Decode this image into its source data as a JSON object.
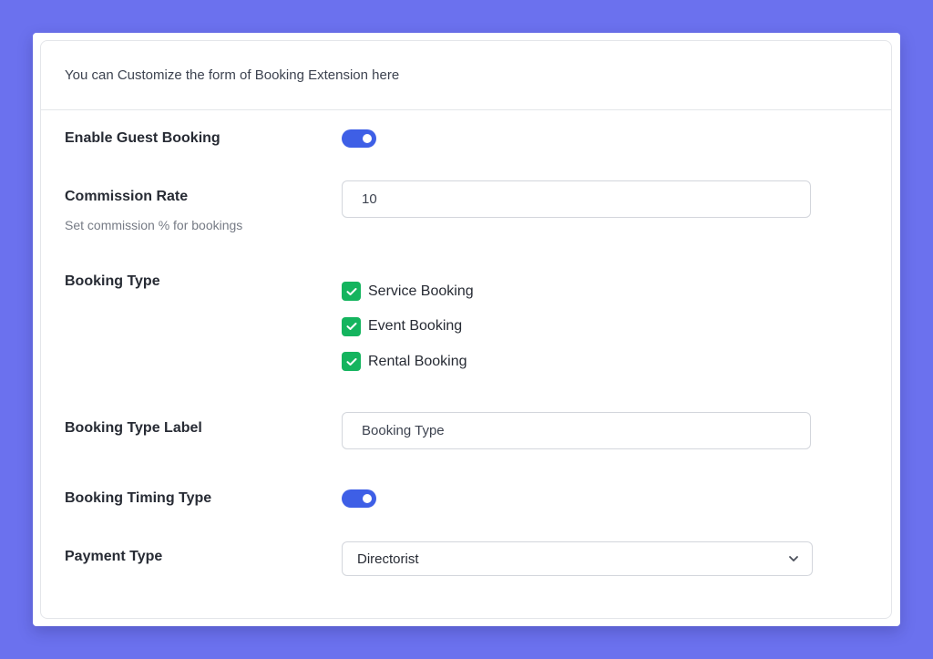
{
  "header": {
    "description": "You can Customize the form of Booking Extension here"
  },
  "settings": {
    "guest_booking": {
      "label": "Enable Guest Booking",
      "enabled": true
    },
    "commission": {
      "label": "Commission Rate",
      "help": "Set commission % for bookings",
      "value": "10"
    },
    "booking_type": {
      "label": "Booking Type",
      "options": [
        {
          "label": "Service Booking",
          "checked": true
        },
        {
          "label": "Event Booking",
          "checked": true
        },
        {
          "label": "Rental Booking",
          "checked": true
        }
      ]
    },
    "booking_type_label": {
      "label": "Booking Type Label",
      "value": "Booking Type"
    },
    "timing_type": {
      "label": "Booking Timing Type",
      "enabled": true
    },
    "payment_type": {
      "label": "Payment Type",
      "selected": "Directorist"
    }
  },
  "colors": {
    "background": "#6b71ee",
    "toggle_on": "#3e5fe6",
    "checkbox_checked": "#14b45e"
  },
  "icons": {
    "checkbox": "check-icon",
    "select": "chevron-down-icon"
  }
}
